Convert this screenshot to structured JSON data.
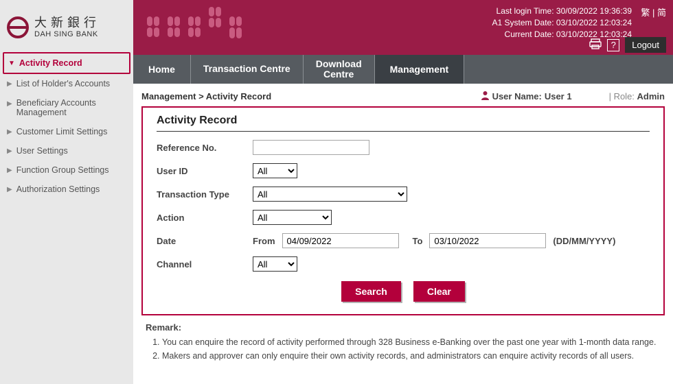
{
  "brand": {
    "cn": "大新銀行",
    "en": "DAH SING BANK"
  },
  "top": {
    "last_login": "Last login Time: 30/09/2022 19:36:39",
    "system_date": "A1 System Date: 03/10/2022 12:03:24",
    "current_date": "Current Date: 03/10/2022 12:03:24",
    "lang_trad": "繁",
    "lang_sep": "|",
    "lang_simp": "简",
    "logout": "Logout"
  },
  "nav": {
    "home": "Home",
    "txn": "Transaction Centre",
    "download": "Download Centre",
    "management": "Management"
  },
  "side": {
    "items": [
      {
        "label": "Activity Record"
      },
      {
        "label": "List of Holder's Accounts"
      },
      {
        "label": "Beneficiary Accounts Management"
      },
      {
        "label": "Customer Limit Settings"
      },
      {
        "label": "User Settings"
      },
      {
        "label": "Function Group Settings"
      },
      {
        "label": "Authorization Settings"
      }
    ]
  },
  "breadcrumb": "Management > Activity Record",
  "user": {
    "name_label": "User Name:",
    "name": "User 1",
    "role_label": "| Role:",
    "role": "Admin"
  },
  "card": {
    "title": "Activity Record",
    "ref_label": "Reference No.",
    "userid_label": "User ID",
    "userid_value": "All",
    "txn_label": "Transaction Type",
    "txn_value": "All",
    "action_label": "Action",
    "action_value": "All",
    "date_label": "Date",
    "from_label": "From",
    "from_value": "04/09/2022",
    "to_label": "To",
    "to_value": "03/10/2022",
    "date_hint": "(DD/MM/YYYY)",
    "channel_label": "Channel",
    "channel_value": "All",
    "search": "Search",
    "clear": "Clear"
  },
  "remark": {
    "title": "Remark:",
    "r1": "You can enquire the record of activity performed through 328 Business e-Banking over the past one year with 1-month data range.",
    "r2": "Makers and approver can only enquire their own activity records, and administrators can enquire activity records of all users."
  }
}
